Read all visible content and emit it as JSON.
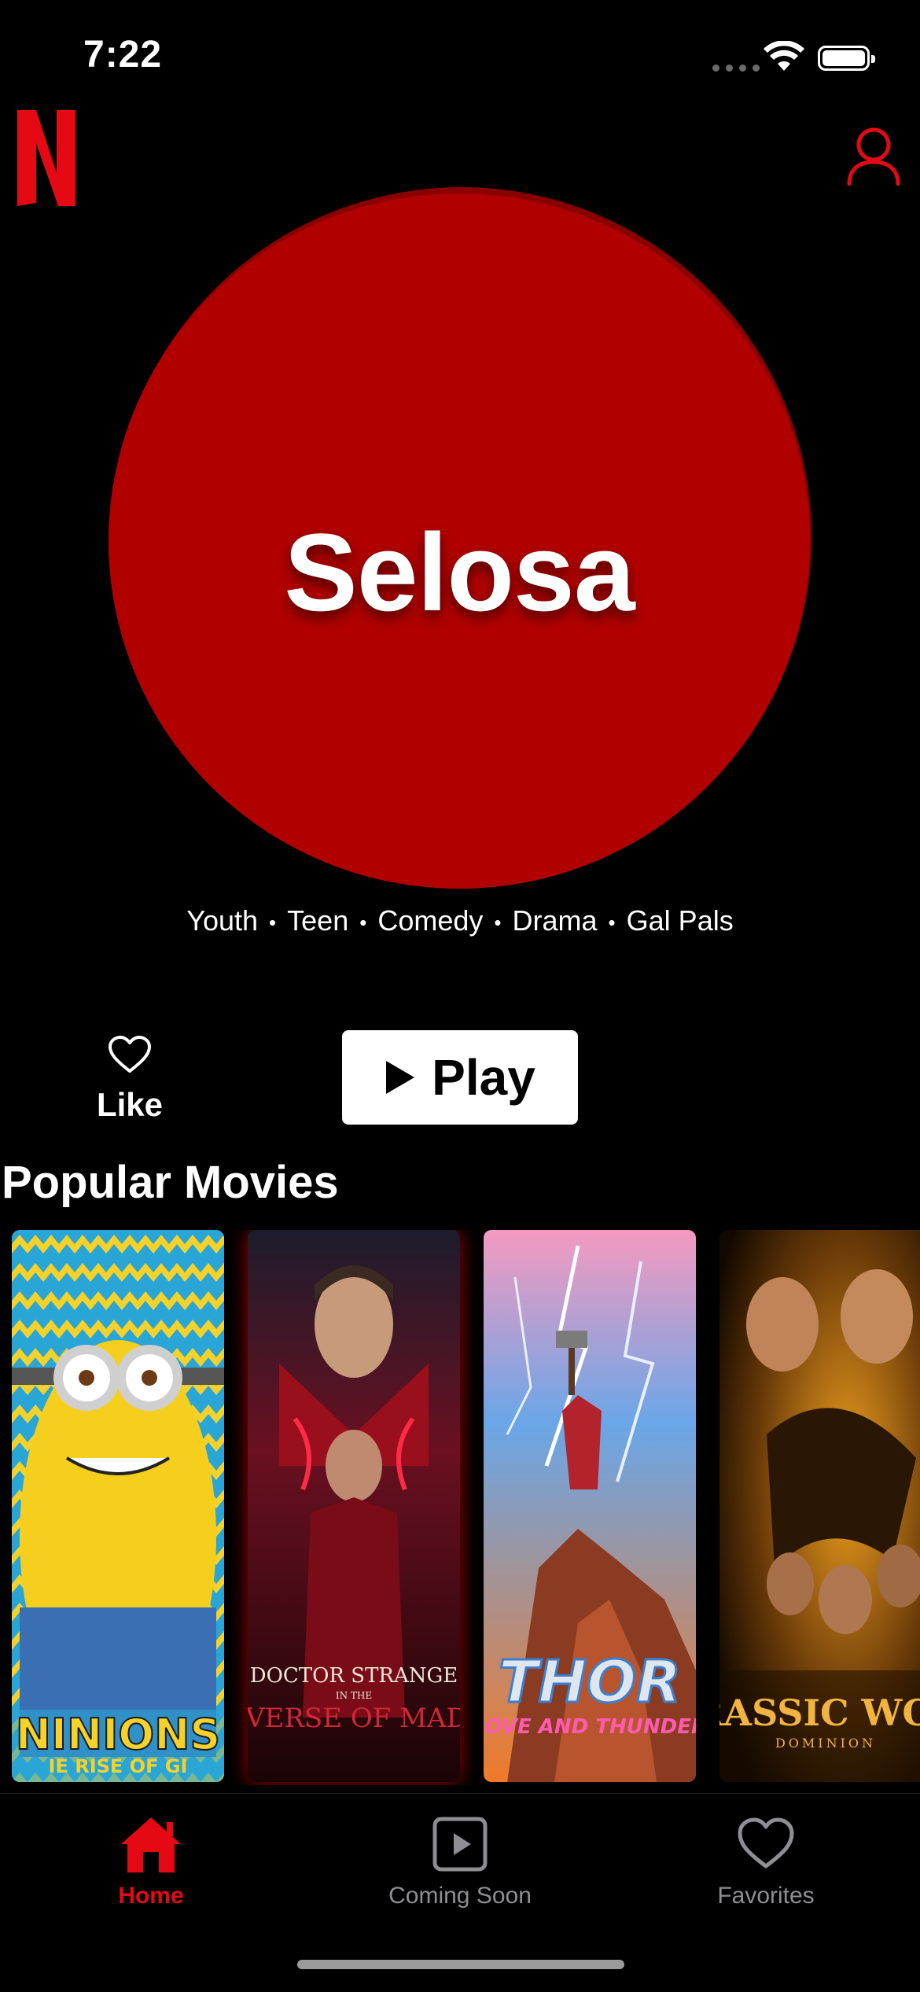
{
  "status_bar": {
    "time": "7:22"
  },
  "header": {
    "logo_icon": "netflix-n-logo",
    "profile_icon": "user-icon",
    "accent": "#e50914"
  },
  "hero": {
    "title": "Selosa",
    "circle_color": "#b10000",
    "genres": [
      "Youth",
      "Teen",
      "Comedy",
      "Drama",
      "Gal Pals"
    ]
  },
  "actions": {
    "like_label": "Like",
    "play_label": "Play"
  },
  "popular": {
    "title": "Popular Movies",
    "posters": [
      {
        "title": "Minions",
        "caption": "NINIONS",
        "subcaption": "IE RISE OF GI"
      },
      {
        "title": "Doctor Strange in the Multiverse of Madness",
        "caption": "DOCTOR STRANGE",
        "subcaption": "IN THE",
        "caption2": "ULTIVERSE OF MADNES"
      },
      {
        "title": "Thor: Love and Thunder",
        "caption": "THOR",
        "subcaption": "LOVE AND THUNDER"
      },
      {
        "title": "Jurassic World Dominion",
        "caption": "URASSIC WORL",
        "subcaption": "DOMINION"
      }
    ]
  },
  "tabbar": {
    "active_color": "#e50914",
    "inactive_color": "#8e8e93",
    "tabs": [
      {
        "label": "Home",
        "icon": "home-icon"
      },
      {
        "label": "Coming Soon",
        "icon": "play-square-icon"
      },
      {
        "label": "Favorites",
        "icon": "heart-icon"
      }
    ]
  }
}
